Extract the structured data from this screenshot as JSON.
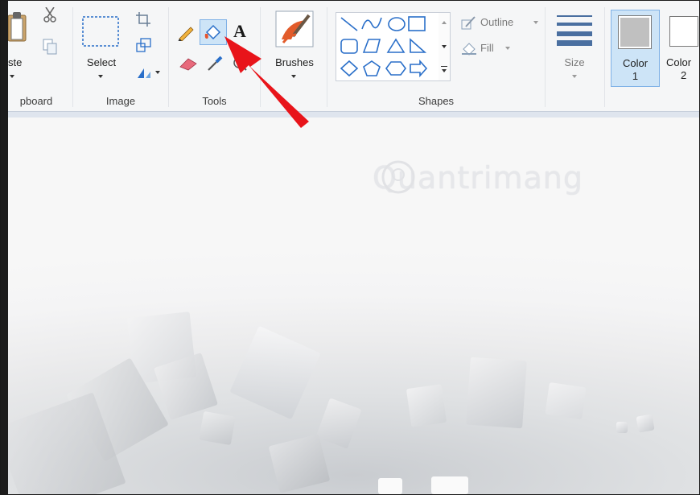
{
  "ribbon": {
    "clipboard": {
      "paste_label": "ste",
      "group_label": "pboard"
    },
    "image": {
      "select_label": "Select",
      "group_label": "Image"
    },
    "tools": {
      "group_label": "Tools"
    },
    "brushes": {
      "label": "Brushes"
    },
    "shapes": {
      "group_label": "Shapes",
      "outline_label": "Outline",
      "fill_label": "Fill"
    },
    "size": {
      "label": "Size"
    },
    "color1": {
      "label_line1": "Color",
      "label_line2": "1",
      "swatch": "#c0c0c0"
    },
    "color2": {
      "label_line1": "Color",
      "label_line2": "2",
      "swatch": "#ffffff"
    }
  },
  "canvas": {
    "watermark": "Quantrimang"
  },
  "annotation": {
    "arrow_color": "#e8141a"
  },
  "colors": {
    "highlight": "#cde4f7",
    "accent": "#3c7fd0"
  }
}
